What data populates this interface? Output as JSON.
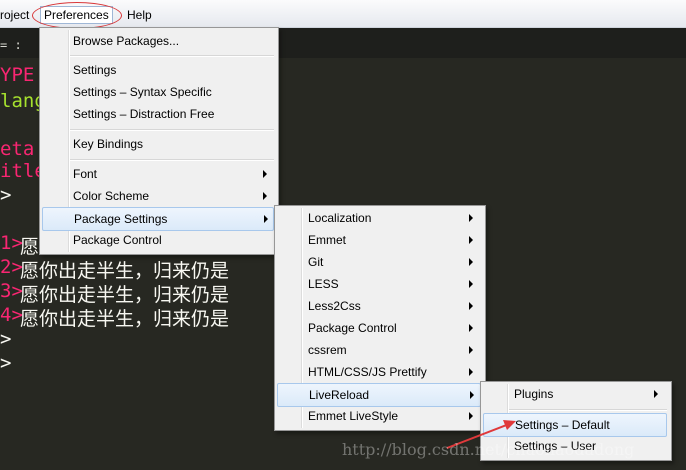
{
  "menubar": {
    "project_label": "roject",
    "preferences_label": "Preferences",
    "help_label": "Help"
  },
  "tab": {
    "fragment": "= :"
  },
  "code": {
    "line1": "YPE",
    "line2": "lang",
    "line3": "eta",
    "line4": "itle",
    "line5": ">",
    "line6_prefix": "1>",
    "line6_text": "愿",
    "line7_prefix": "2>",
    "line7_text": "愿你出走半生，归来仍是",
    "line8_prefix": "3>",
    "line8_text": "愿你出走半生，归来仍是",
    "line9_prefix": "4>",
    "line9_text": "愿你出走半生，归来仍是",
    "line10": ">",
    "line11": ">"
  },
  "preferences_menu": {
    "browse_packages": "Browse Packages...",
    "settings": "Settings",
    "settings_syntax": "Settings – Syntax Specific",
    "settings_distraction": "Settings – Distraction Free",
    "key_bindings": "Key Bindings",
    "font": "Font",
    "color_scheme": "Color Scheme",
    "package_settings": "Package Settings",
    "package_control": "Package Control"
  },
  "package_settings_menu": {
    "items": [
      "Localization",
      "Emmet",
      "Git",
      "LESS",
      "Less2Css",
      "Package Control",
      "cssrem",
      "HTML/CSS/JS Prettify",
      "LiveReload",
      "Emmet LiveStyle"
    ]
  },
  "livereload_menu": {
    "plugins": "Plugins",
    "settings_default": "Settings – Default",
    "settings_user": "Settings – User"
  },
  "watermark": "http://blog.csdn.net/chaohaodadong",
  "colors": {
    "editor_bg": "#272822",
    "keyword": "#f92672",
    "attribute": "#a6e22e",
    "menu_bg": "#f0f0f0",
    "highlight": "#dbeaf9",
    "annotation_red": "#d9383a"
  }
}
